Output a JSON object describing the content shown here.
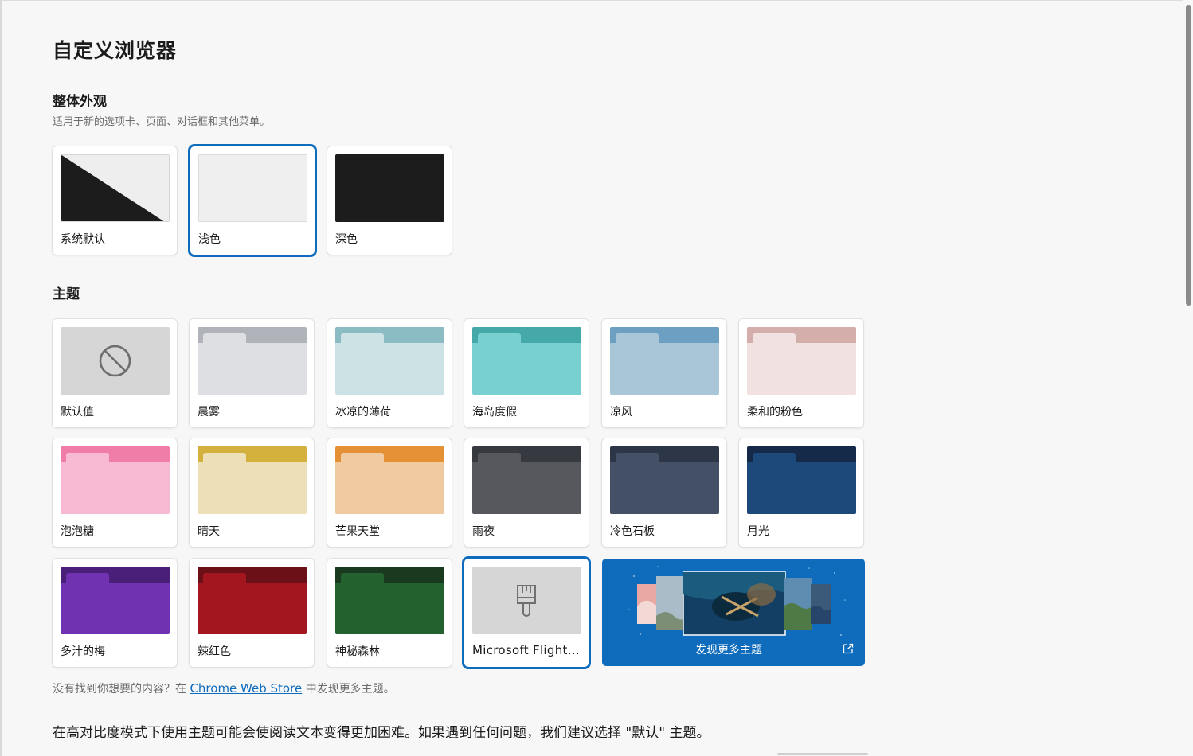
{
  "page": {
    "title": "自定义浏览器"
  },
  "appearance": {
    "title": "整体外观",
    "description": "适用于新的选项卡、页面、对话框和其他菜单。",
    "options": [
      {
        "label": "系统默认",
        "selected": false
      },
      {
        "label": "浅色",
        "selected": true
      },
      {
        "label": "深色",
        "selected": false
      }
    ]
  },
  "themes": {
    "title": "主题",
    "items": [
      {
        "label": "默认值",
        "icon": "no-entry-icon"
      },
      {
        "label": "晨雾",
        "tab_color": "#b0b4ba",
        "body_color": "#dddfe3"
      },
      {
        "label": "冰凉的薄荷",
        "tab_color": "#8cbcc3",
        "body_color": "#cde2e5"
      },
      {
        "label": "海岛度假",
        "tab_color": "#45a9a9",
        "body_color": "#78d1d0"
      },
      {
        "label": "凉风",
        "tab_color": "#6d9fc2",
        "body_color": "#a9c6d9"
      },
      {
        "label": "柔和的粉色",
        "tab_color": "#d4aeab",
        "body_color": "#f1e1e0"
      },
      {
        "label": "泡泡糖",
        "tab_color": "#f07ca8",
        "body_color": "#f8bad3"
      },
      {
        "label": "晴天",
        "tab_color": "#d4b03d",
        "body_color": "#ede0b9"
      },
      {
        "label": "芒果天堂",
        "tab_color": "#e49135",
        "body_color": "#f0caa0"
      },
      {
        "label": "雨夜",
        "tab_color": "#36393f",
        "body_color": "#56585d"
      },
      {
        "label": "冷色石板",
        "tab_color": "#2c3647",
        "body_color": "#435066"
      },
      {
        "label": "月光",
        "tab_color": "#152a48",
        "body_color": "#1d487a"
      },
      {
        "label": "多汁的梅",
        "tab_color": "#4a1f79",
        "body_color": "#7132b2"
      },
      {
        "label": "辣红色",
        "tab_color": "#6a1016",
        "body_color": "#a3151f"
      },
      {
        "label": "神秘森林",
        "tab_color": "#193a1e",
        "body_color": "#23612e"
      },
      {
        "label": "Microsoft Flight ...",
        "icon": "paintbrush-icon",
        "selected": true
      }
    ],
    "discover_label": "发现更多主题",
    "discover_icon": "external-link-icon"
  },
  "footer": {
    "prefix": "没有找到你想要的内容？在 ",
    "link": "Chrome Web Store",
    "suffix": " 中发现更多主题。",
    "high_contrast_note": "在高对比度模式下使用主题可能会使阅读文本变得更加困难。如果遇到任何问题，我们建议选择 \"默认\" 主题。"
  },
  "colors": {
    "accent": "#0f6cbd",
    "background": "#f7f7f7"
  }
}
